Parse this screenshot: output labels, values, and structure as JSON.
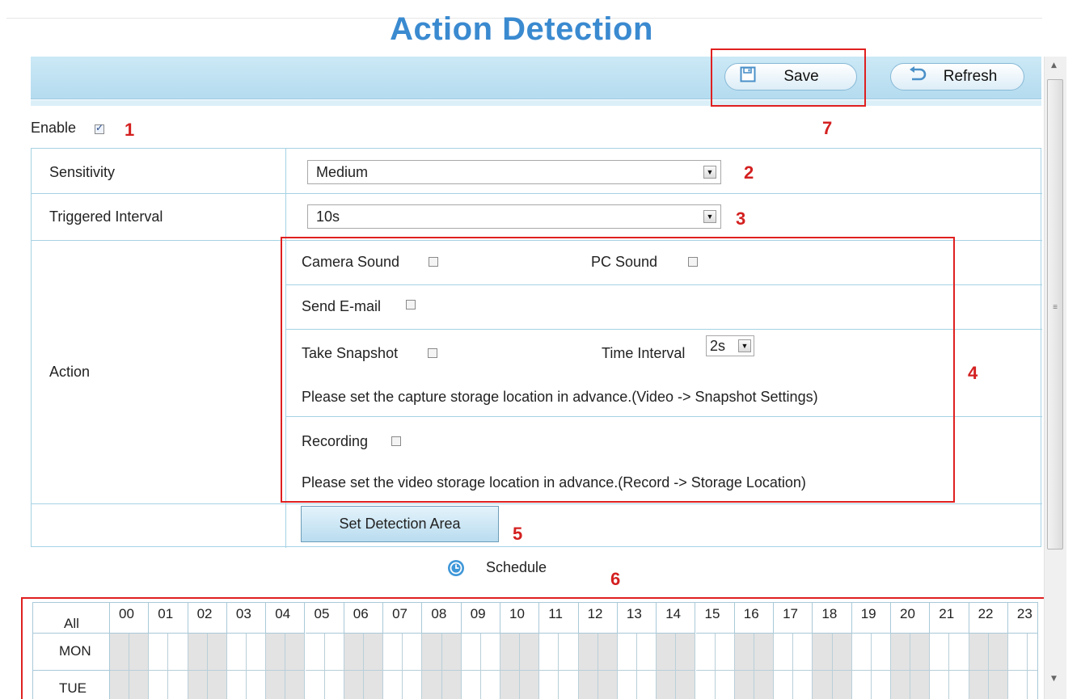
{
  "page": {
    "title": "Action Detection"
  },
  "toolbar": {
    "save_label": "Save",
    "refresh_label": "Refresh"
  },
  "enable": {
    "label": "Enable",
    "checked": true
  },
  "sensitivity": {
    "label": "Sensitivity",
    "value": "Medium"
  },
  "interval": {
    "label": "Triggered Interval",
    "value": "10s"
  },
  "action": {
    "label": "Action",
    "camera_sound": "Camera Sound",
    "pc_sound": "PC Sound",
    "send_email": "Send E-mail",
    "take_snapshot": "Take Snapshot",
    "time_interval_label": "Time Interval",
    "time_interval_value": "2s",
    "snapshot_note": "Please set the capture storage location in advance.(Video -> Snapshot Settings)",
    "recording": "Recording",
    "recording_note": "Please set the video storage location in advance.(Record -> Storage Location)"
  },
  "detection_area_button": "Set Detection Area",
  "schedule": {
    "title": "Schedule",
    "all_label": "All",
    "days": [
      "MON",
      "TUE"
    ],
    "hours": [
      "00",
      "01",
      "02",
      "03",
      "04",
      "05",
      "06",
      "07",
      "08",
      "09",
      "10",
      "11",
      "12",
      "13",
      "14",
      "15",
      "16",
      "17",
      "18",
      "19",
      "20",
      "21",
      "22",
      "23"
    ]
  },
  "markers": {
    "m1": "1",
    "m2": "2",
    "m3": "3",
    "m4": "4",
    "m5": "5",
    "m6": "6",
    "m7": "7"
  },
  "colors": {
    "title": "#3a8ad0",
    "highlight_box": "#e02020",
    "border": "#a6d2e4",
    "toolbar": "#c3e3f3"
  }
}
